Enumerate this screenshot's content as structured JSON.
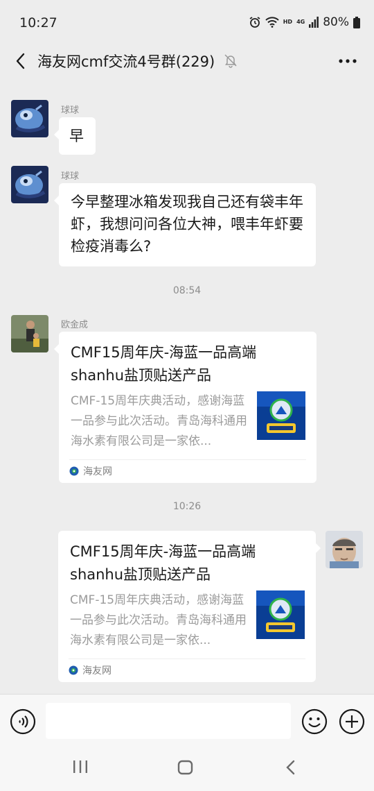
{
  "status_bar": {
    "time": "10:27",
    "hd_label": "HD",
    "network_label": "4G",
    "battery": "80%"
  },
  "header": {
    "title": "海友网cmf交流4号群(229)",
    "back_icon": "back-arrow-icon",
    "mute_icon": "bell-off-icon",
    "more_icon": "more-dots-icon"
  },
  "messages": [
    {
      "type": "text",
      "side": "left",
      "sender": "球球",
      "text": "早"
    },
    {
      "type": "text",
      "side": "left",
      "sender": "球球",
      "text": "今早整理冰箱发现我自己还有袋丰年虾，我想问问各位大神，喂丰年虾要检疫消毒么?"
    },
    {
      "type": "time",
      "text": "08:54"
    },
    {
      "type": "card",
      "side": "left",
      "sender": "欧金成",
      "title": "CMF15周年庆-海蓝一品高端shanhu盐顶贴送产品",
      "desc": "CMF-15周年庆典活动，感谢海蓝一品参与此次活动。青岛海科通用海水素有限公司是一家依...",
      "source": "海友网"
    },
    {
      "type": "time",
      "text": "10:26"
    },
    {
      "type": "card",
      "side": "right",
      "sender": "",
      "title": "CMF15周年庆-海蓝一品高端shanhu盐顶贴送产品",
      "desc": "CMF-15周年庆典活动，感谢海蓝一品参与此次活动。青岛海科通用海水素有限公司是一家依...",
      "source": "海友网"
    }
  ],
  "input_bar": {
    "voice_icon": "voice-icon",
    "text_value": "",
    "emoji_icon": "emoji-icon",
    "plus_icon": "plus-icon"
  },
  "colors": {
    "background": "#ededed",
    "bubble": "#ffffff",
    "secondary_text": "#8c8c8c",
    "input_bar": "#f7f7f7"
  }
}
